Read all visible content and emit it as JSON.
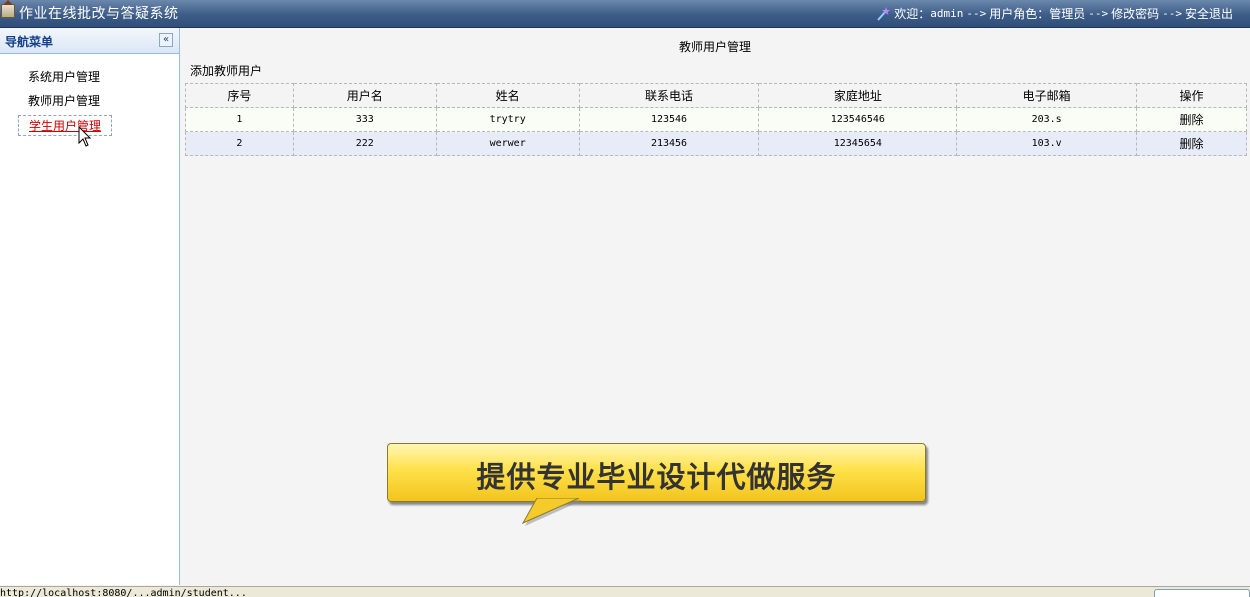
{
  "header": {
    "app_title": "作业在线批改与答疑系统",
    "welcome_label": "欢迎：",
    "username": "admin",
    "arrow": "-->",
    "role_text": "用户角色：管理员",
    "change_password": "修改密码",
    "logout": "安全退出",
    "app_icon": "home-icon",
    "wand_icon": "magic-wand-icon"
  },
  "sidebar": {
    "title": "导航菜单",
    "collapse_symbol": "«",
    "items": [
      {
        "label": "系统用户管理"
      },
      {
        "label": "教师用户管理"
      },
      {
        "label": "学生用户管理"
      }
    ],
    "active_index": 2
  },
  "main": {
    "page_title": "教师用户管理",
    "add_link": "添加教师用户",
    "columns": [
      "序号",
      "用户名",
      "姓名",
      "联系电话",
      "家庭地址",
      "电子邮箱",
      "操作"
    ],
    "rows": [
      {
        "no": "1",
        "username": "333",
        "name": "trytry",
        "phone": "123546",
        "address": "123546546",
        "email": "203.s",
        "action": "删除"
      },
      {
        "no": "2",
        "username": "222",
        "name": "werwer",
        "phone": "213456",
        "address": "12345654",
        "email": "103.v",
        "action": "删除"
      }
    ]
  },
  "banner": {
    "text": "提供专业毕业设计代做服务",
    "colors": {
      "top": "#fff7b5",
      "bottom": "#f2c41f"
    }
  },
  "statusbar": {
    "url_text": "http://localhost:8080/...admin/student..."
  },
  "colors": {
    "header_dark": "#2f4e79",
    "sidebar_title": "#15428b",
    "active_link": "#cc0000",
    "row_alt": "#e8ecf8"
  }
}
